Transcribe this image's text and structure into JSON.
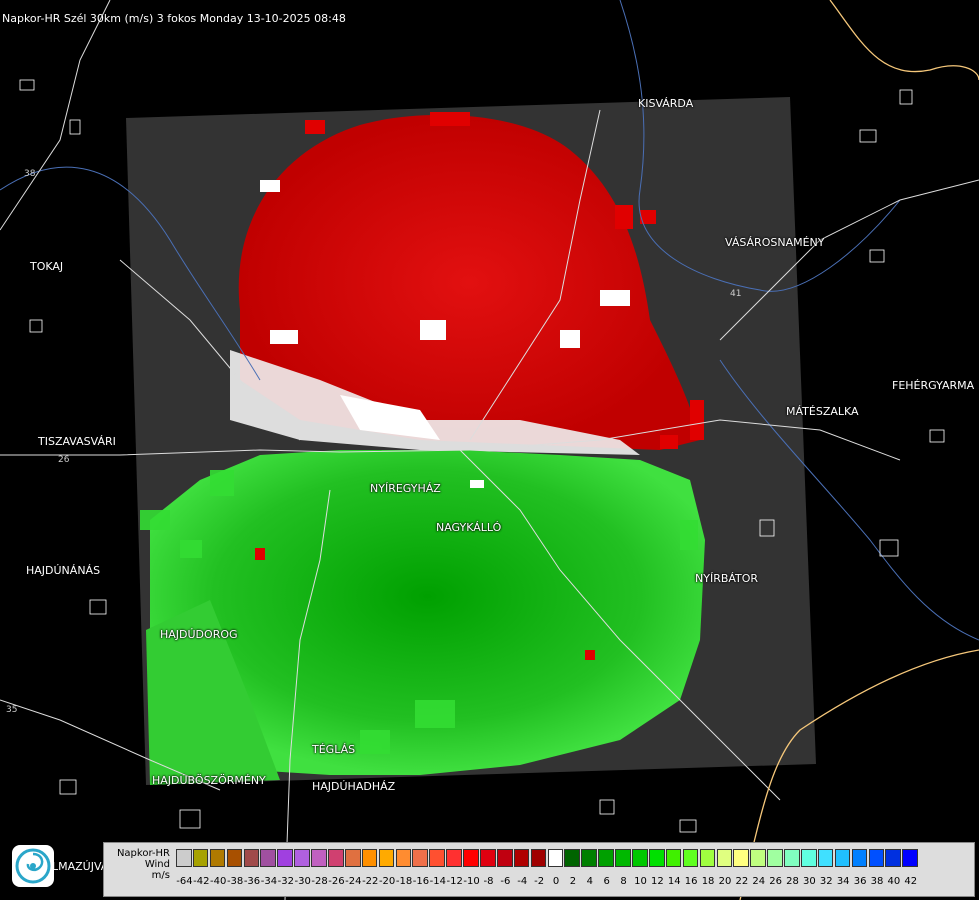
{
  "header": {
    "title": "Napkor-HR Szél 30km (m/s) 3 fokos Monday 13-10-2025 08:48"
  },
  "towns": [
    {
      "id": "kisvarda",
      "name": "KISVÁRDA"
    },
    {
      "id": "tokaj",
      "name": "TOKAJ"
    },
    {
      "id": "vasarosnameny",
      "name": "VÁSÁROSNAMÉNY"
    },
    {
      "id": "fehergyarmat",
      "name": "FEHÉRGYARMA"
    },
    {
      "id": "mateszalka",
      "name": "MÁTÉSZALKA"
    },
    {
      "id": "tiszavasvari",
      "name": "TISZAVASVÁRI"
    },
    {
      "id": "nyiregyhaza",
      "name": "NYÍREGYHÁZ"
    },
    {
      "id": "nagykallo",
      "name": "NAGYKÁLLÓ"
    },
    {
      "id": "hajdunanas",
      "name": "HAJDÚNÁNÁS"
    },
    {
      "id": "nyirbator",
      "name": "NYÍRBÁTOR"
    },
    {
      "id": "hajdudorog",
      "name": "HAJDÚDOROG"
    },
    {
      "id": "teglas",
      "name": "TÉGLÁS"
    },
    {
      "id": "hajduboszormeny",
      "name": "HAJDÚBÖSZÖRMÉNY"
    },
    {
      "id": "hajduhadhaz",
      "name": "HAJDÚHADHÁZ"
    },
    {
      "id": "almazujvaros",
      "name": "LMAZÚJVÁR"
    }
  ],
  "road_labels": [
    "26",
    "35",
    "41",
    "38"
  ],
  "legend": {
    "title_lines": [
      "Napkor-HR",
      "Wind",
      "m/s"
    ],
    "labels": [
      "-64",
      "-42",
      "-40",
      "-38",
      "-36",
      "-34",
      "-32",
      "-30",
      "-28",
      "-26",
      "-24",
      "-22",
      "-20",
      "-18",
      "-16",
      "-14",
      "-12",
      "-10",
      "-8",
      "-6",
      "-4",
      "-2",
      "0",
      "2",
      "4",
      "6",
      "8",
      "10",
      "12",
      "14",
      "16",
      "18",
      "20",
      "22",
      "24",
      "26",
      "28",
      "30",
      "32",
      "34",
      "36",
      "38",
      "40",
      "42"
    ],
    "colors": [
      "#cccccc",
      "#a7a200",
      "#b07a00",
      "#a85000",
      "#a04a4a",
      "#a050a0",
      "#a040e0",
      "#b060e0",
      "#c060c0",
      "#d04070",
      "#e07040",
      "#ff9000",
      "#ffaa00",
      "#ff8c30",
      "#f0704a",
      "#ff5030",
      "#ff3030",
      "#ff0000",
      "#e00010",
      "#c00010",
      "#b00000",
      "#a00000",
      "#ffffff",
      "#006400",
      "#008000",
      "#00a000",
      "#00b800",
      "#00c800",
      "#00e000",
      "#40f000",
      "#60ff20",
      "#a0ff40",
      "#e0ff80",
      "#ffff80",
      "#c0ff80",
      "#a0ffa0",
      "#80ffc0",
      "#60ffe0",
      "#40e0ff",
      "#20c0ff",
      "#0080ff",
      "#0050ff",
      "#0030e0",
      "#0000ff"
    ]
  },
  "radar": {
    "color_receding": "#e00000",
    "color_approaching": "#00a000",
    "color_zero": "#ffffff",
    "background": "#333333"
  }
}
